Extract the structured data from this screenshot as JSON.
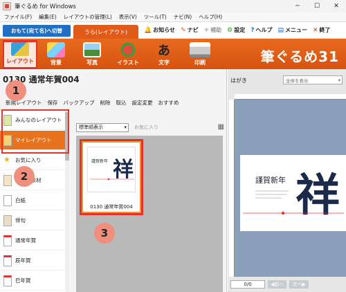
{
  "window": {
    "title": "筆ぐるめ for Windows",
    "controls": [
      "─",
      "☐",
      "✕"
    ]
  },
  "menu": [
    "ファイル(F)",
    "編集(E)",
    "レイアウトの管理(L)",
    "表示(V)",
    "ツール(T)",
    "ナビ(N)",
    "ヘルプ(H)"
  ],
  "tabs": {
    "omote": "おもて(宛て名)へ切替",
    "ura": "うら(レイアウト)"
  },
  "toplinks": [
    {
      "label": "お知らせ",
      "icon": "bell-icon"
    },
    {
      "label": "ナビ",
      "icon": "pencil-icon"
    },
    {
      "label": "補助",
      "icon": "helper-icon"
    },
    {
      "label": "設定",
      "icon": "gear-icon"
    },
    {
      "label": "ヘルプ",
      "icon": "help-icon"
    },
    {
      "label": "メニュー",
      "icon": "menu-icon"
    },
    {
      "label": "終了",
      "icon": "close-icon"
    }
  ],
  "ribbon": [
    {
      "label": "レイアウト",
      "icon": "layout-icon"
    },
    {
      "label": "背景",
      "icon": "background-icon"
    },
    {
      "label": "写真",
      "icon": "photo-icon"
    },
    {
      "label": "イラスト",
      "icon": "illustration-icon"
    },
    {
      "label": "文字",
      "icon": "text-icon"
    },
    {
      "label": "印刷",
      "icon": "printer-icon"
    }
  ],
  "brand": "筆ぐるめ31",
  "design_title": "0130 通常年賀004",
  "commands": [
    "新規レイアウト",
    "保存",
    "バックアップ",
    "削除",
    "取込",
    "設定変更",
    "おすすめ"
  ],
  "sidebar": [
    {
      "label": "みんなのレイアウト"
    },
    {
      "label": "マイレイアウト"
    },
    {
      "label": "お気に入り"
    },
    {
      "label": "はがき素材"
    },
    {
      "label": "白紙"
    },
    {
      "label": "俳句"
    },
    {
      "label": "通常年賀"
    },
    {
      "label": "辰年賀"
    },
    {
      "label": "巳年賀"
    }
  ],
  "gallery": {
    "sort": "標準順表示",
    "favorites": "お気に入り",
    "items": [
      {
        "caption": "0130 通常年賀004"
      }
    ]
  },
  "card_text": {
    "greeting": "謹賀新年",
    "kanji": "祥"
  },
  "callouts": [
    "1",
    "2",
    "3"
  ],
  "preview": {
    "label": "はがき",
    "zoom": "全体を表示",
    "page": "0/0",
    "prev": "前へ",
    "next": "次へ"
  },
  "colors": {
    "accent": "#e05a19",
    "highlight": "#e3322b",
    "tab_blue": "#1f6fc4"
  }
}
